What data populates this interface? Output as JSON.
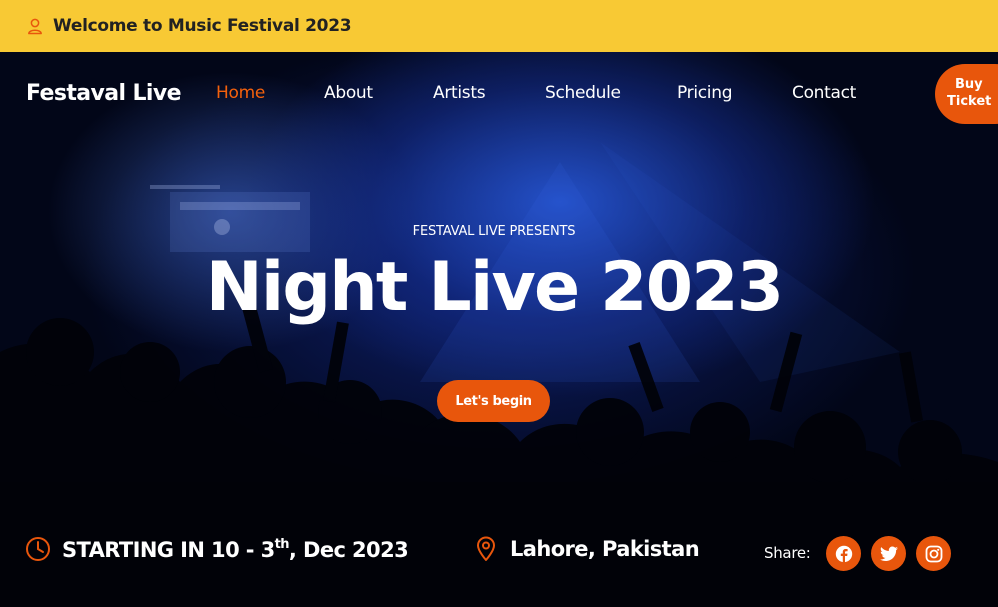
{
  "topbar": {
    "welcome_text": "Welcome to Music Festival 2023",
    "icon": "user-icon"
  },
  "nav": {
    "brand": "Festaval Live",
    "links": [
      {
        "label": "Home",
        "active": true
      },
      {
        "label": "About",
        "active": false
      },
      {
        "label": "Artists",
        "active": false
      },
      {
        "label": "Schedule",
        "active": false
      },
      {
        "label": "Pricing",
        "active": false
      },
      {
        "label": "Contact",
        "active": false
      }
    ],
    "buy_ticket_line1": "Buy",
    "buy_ticket_line2": "Ticket"
  },
  "hero": {
    "presents": "FESTAVAL LIVE PRESENTS",
    "title": "Night Live 2023",
    "cta": "Let's begin"
  },
  "info": {
    "date_prefix": "STARTING IN 10 - 3",
    "date_sup": "th",
    "date_suffix": ", Dec 2023",
    "location": "Lahore, Pakistan",
    "share_label": "Share:",
    "social_icons": [
      "facebook-icon",
      "twitter-icon",
      "instagram-icon"
    ]
  },
  "colors": {
    "accent": "#e8560c",
    "topbar": "#f8c934",
    "active_link": "#f4610c"
  }
}
